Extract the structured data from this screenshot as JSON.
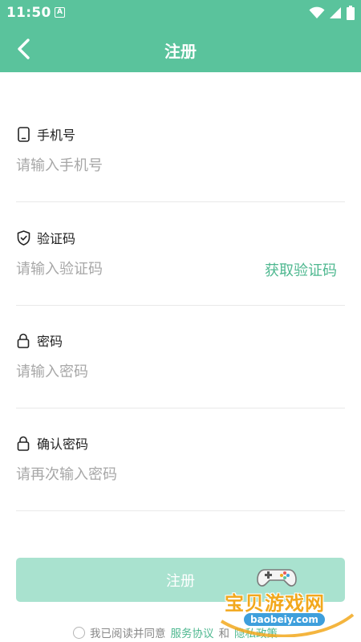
{
  "status_bar": {
    "time": "11:50",
    "notification_glyph": "A",
    "icons": [
      "wifi-icon",
      "signal-icon",
      "battery-icon"
    ]
  },
  "header": {
    "title": "注册",
    "back_icon": "chevron-left-icon"
  },
  "form": {
    "phone": {
      "label": "手机号",
      "placeholder": "请输入手机号",
      "value": "",
      "icon": "phone-icon"
    },
    "code": {
      "label": "验证码",
      "placeholder": "请输入验证码",
      "value": "",
      "icon": "shield-check-icon",
      "get_code_label": "获取验证码"
    },
    "password": {
      "label": "密码",
      "placeholder": "请输入密码",
      "value": "",
      "icon": "lock-icon"
    },
    "confirm": {
      "label": "确认密码",
      "placeholder": "请再次输入密码",
      "value": "",
      "icon": "lock-icon"
    }
  },
  "submit_label": "注册",
  "agreement": {
    "prefix": "我已阅读并同意",
    "service": "服务协议",
    "and": "和",
    "privacy": "隐私政策",
    "checked": false
  },
  "watermark": {
    "text": "宝贝游戏网",
    "url": "baobeiy.com"
  },
  "colors": {
    "primary": "#5ac39c",
    "button_disabled": "#a9e2cf",
    "link": "#4fb890",
    "placeholder": "#a7a7a7"
  }
}
